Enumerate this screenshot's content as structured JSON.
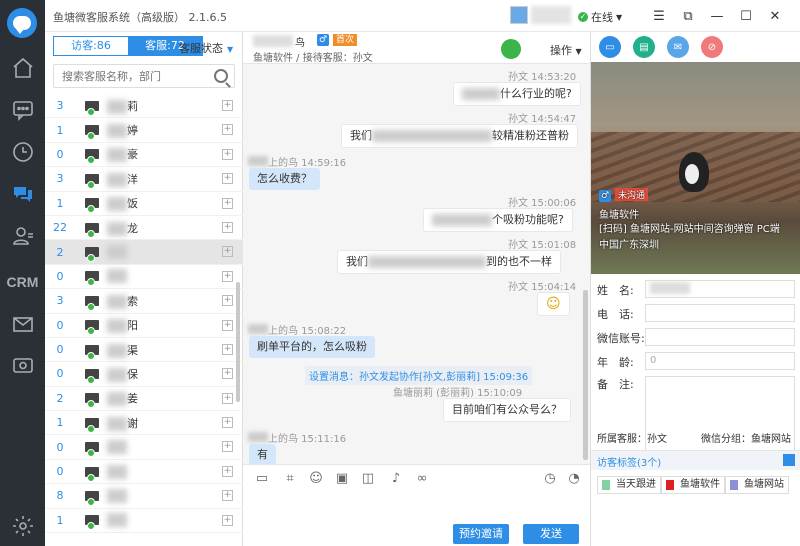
{
  "app": {
    "title": "鱼塘微客服系统（高级版） 2.1.6.5",
    "status": "在线",
    "status_color": "#3bb54a",
    "accent": "#2e8ee6"
  },
  "rail": {
    "items": [
      {
        "icon": "home-icon"
      },
      {
        "icon": "chat-bubble-icon"
      },
      {
        "icon": "clock-icon"
      },
      {
        "icon": "messages-icon"
      },
      {
        "icon": "contacts-icon"
      },
      {
        "icon": "crm-icon",
        "label": "CRM"
      },
      {
        "icon": "mail-icon"
      },
      {
        "icon": "eye-icon"
      },
      {
        "icon": "settings-icon"
      }
    ]
  },
  "contacts": {
    "tab_visitors": "访客:86",
    "tab_agents": "客服:72",
    "status_label": "客服状态",
    "search_placeholder": "搜索客服名称，部门",
    "rows": [
      {
        "count": "3",
        "name": "莉"
      },
      {
        "count": "1",
        "name": "婷"
      },
      {
        "count": "0",
        "name": "豪"
      },
      {
        "count": "3",
        "name": "洋"
      },
      {
        "count": "1",
        "name": "饭"
      },
      {
        "count": "22",
        "name": "龙"
      },
      {
        "count": "2",
        "name": ""
      },
      {
        "count": "0",
        "name": ""
      },
      {
        "count": "3",
        "name": "索"
      },
      {
        "count": "0",
        "name": "阳"
      },
      {
        "count": "0",
        "name": "渠"
      },
      {
        "count": "0",
        "name": "保"
      },
      {
        "count": "2",
        "name": "姜"
      },
      {
        "count": "1",
        "name": "谢"
      },
      {
        "count": "0",
        "name": ""
      },
      {
        "count": "0",
        "name": ""
      },
      {
        "count": "8",
        "name": ""
      },
      {
        "count": "1",
        "name": ""
      }
    ]
  },
  "chat": {
    "contact_name": "鸟",
    "first_tag": "首次",
    "subtitle": "鱼塘软件 / 接待客服：孙文",
    "ops": "操作",
    "messages": [
      {
        "side": "me",
        "meta": "孙文  14:53:20",
        "text": "什么行业的呢?"
      },
      {
        "side": "me",
        "meta": "孙文  14:54:47",
        "text_a": "我们",
        "text_b": "较精准粉还普粉"
      },
      {
        "side": "them",
        "meta": "上的鸟 14:59:16",
        "text": "怎么收费？"
      },
      {
        "side": "me",
        "meta": "孙文  15:00:06",
        "text": "个吸粉功能呢?"
      },
      {
        "side": "me",
        "meta": "孙文  15:01:08",
        "text_a": "我们",
        "text_b": "到的也不一样"
      },
      {
        "side": "me",
        "meta": "孙文  15:04:14",
        "text": "☺"
      },
      {
        "side": "them",
        "meta": "上的鸟 15:08:22",
        "text": "刷单平台的，怎么吸粉"
      },
      {
        "side": "me",
        "meta": "鱼塘丽莉  (彭丽莉)  15:10:09",
        "text": "目前咱们有公众号么？"
      },
      {
        "side": "them",
        "meta": "上的鸟 15:11:16",
        "text": "有"
      }
    ],
    "system_msg": "设置消息：孙文发起协作[孙文,彭丽莉] 15:09:36",
    "invite_btn": "预约邀请",
    "send_btn": "发送"
  },
  "info": {
    "tag_unfollowed": "未沟通",
    "company": "鱼塘软件",
    "source": "[扫码] 鱼塘网站-网站中间咨询弹窗 PC端",
    "location": "中国广东深圳",
    "fields": {
      "name_label": "姓　名:",
      "phone_label": "电　话:",
      "wechat_label": "微信账号:",
      "age_label": "年　龄:",
      "age_value": "0",
      "note_label": "备　注:"
    },
    "owner": "所属客服：孙文",
    "wx_group": "微信分组：鱼塘网站",
    "tags_title": "访客标签(3个)",
    "tags": [
      {
        "label": "当天跟进",
        "color": "#7ed3a0"
      },
      {
        "label": "鱼塘软件",
        "color": "#e02020"
      },
      {
        "label": "鱼塘网站",
        "color": "#8a8fd6"
      }
    ]
  }
}
